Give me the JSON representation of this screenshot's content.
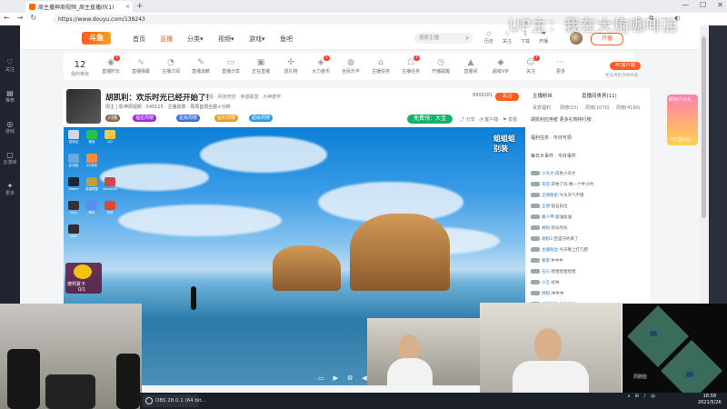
{
  "browser": {
    "tab_title": "周主播神周视频_周主直播间(1)",
    "tab_close": "×",
    "new_tab": "+",
    "window_controls": [
      "—",
      "☐",
      "✕"
    ],
    "url": "https://www.douyu.com/138243",
    "nav": [
      "←",
      "→",
      "↻"
    ],
    "tools": [
      "☆",
      "⧉",
      "⋯",
      "◐"
    ]
  },
  "watermark": "UP主：我在大炮咖啡店",
  "sidebar": {
    "items": [
      {
        "icon": "♡",
        "label": "关注"
      },
      {
        "icon": "▤",
        "label": "推荐"
      },
      {
        "icon": "◎",
        "label": "游戏"
      },
      {
        "icon": "▢",
        "label": "云游戏"
      },
      {
        "icon": "✦",
        "label": "更多"
      }
    ]
  },
  "site": {
    "logo": "斗鱼",
    "nav": [
      "首页",
      "直播",
      "分类",
      "视频",
      "游戏",
      "鱼吧"
    ],
    "nav_arrows": [
      "",
      "",
      "▾",
      "▾",
      "▾",
      ""
    ],
    "search_placeholder": "搜索主播",
    "search_icon": "⌕",
    "topics": [
      {
        "icon": "◇",
        "label": "历史"
      },
      {
        "icon": "☆",
        "label": "关注"
      },
      {
        "icon": "⇩",
        "label": "下载"
      },
      {
        "icon": "⚑",
        "label": "开播"
      }
    ],
    "open_live": "开播"
  },
  "tasks": {
    "level": "12",
    "level_label": "我的等级",
    "items": [
      {
        "icon": "◉",
        "label": "直播时长",
        "badge": "1"
      },
      {
        "icon": "∿",
        "label": "直播弹幕",
        "badge": ""
      },
      {
        "icon": "◔",
        "label": "主播订阅",
        "badge": ""
      },
      {
        "icon": "✎",
        "label": "直播道歉",
        "badge": ""
      },
      {
        "icon": "▭",
        "label": "直播分享",
        "badge": ""
      },
      {
        "icon": "▣",
        "label": "正在直播",
        "badge": ""
      },
      {
        "icon": "✣",
        "label": "送礼物",
        "badge": ""
      },
      {
        "icon": "◈",
        "label": "大力金币",
        "badge": "1"
      },
      {
        "icon": "◍",
        "label": "全民乐平",
        "badge": ""
      },
      {
        "icon": "⌂",
        "label": "主播任务",
        "badge": ""
      },
      {
        "icon": "☖",
        "label": "主播任务",
        "badge": "1"
      },
      {
        "icon": "◷",
        "label": "开播提醒",
        "badge": ""
      },
      {
        "icon": "▲",
        "label": "直播间",
        "badge": ""
      },
      {
        "icon": "◆",
        "label": "超级VIP",
        "badge": ""
      },
      {
        "icon": "☺",
        "label": "关注",
        "badge": "1"
      },
      {
        "icon": "⋯",
        "label": "更多",
        "badge": ""
      }
    ],
    "pc_client": "PC客户端",
    "pc_sub": "更高清更流畅体验"
  },
  "room": {
    "title": "胡凯利：欢乐时光已经开始了！",
    "subtitle": "举报 · 网游竞技 · 英雄联盟 · 大神教学",
    "stats": "周主 | 影神周视频 · 540115 · 主播勋章 · 周周首周全勤+分钟",
    "chips": [
      {
        "text": "闪播",
        "color": "#8a6b4a"
      },
      {
        "text": "福星周榜",
        "color": "#9c2bd6"
      },
      {
        "text": "星级周榜",
        "color": "#3c6fe0"
      },
      {
        "text": "钻石周榜",
        "color": "#e3a21b"
      },
      {
        "text": "超级周榜",
        "color": "#2b9be0"
      }
    ],
    "hot": "8900281",
    "follow": "关注",
    "free_gift": "免费领：大宝",
    "tools": "⤴ 分享 · ◔ 客户端 · ⚑ 举报"
  },
  "player": {
    "overlay_text": [
      "蛆蛆蛆",
      "别装"
    ],
    "controls": [
      "▭",
      "▶",
      "⚙",
      "◀)",
      "⛶",
      "⤢"
    ],
    "desktop_icons": [
      "回收站",
      "微信",
      "QQ",
      "此电脑",
      "QQ音乐",
      "Steam",
      "英雄联盟",
      "WeGame",
      "Epic",
      "腾讯",
      "网易",
      "OBS"
    ],
    "game_badge_title": "德邦夏卡",
    "game_badge_num": "0/1"
  },
  "chat": {
    "tabs": [
      "主播粉丝",
      "直播间贵宾(11)"
    ],
    "subs": [
      "贵宾福利",
      "周榜(10)",
      "周榜(1070)",
      "周榜(4190)"
    ],
    "rank_rows": [
      "胡凯利应用者 更多礼物排行榜",
      "福利任务 · 今日可领",
      "每日大事件 · 今日事件"
    ],
    "lines": [
      {
        "user": "小天才:",
        "text": "白色小天才"
      },
      {
        "user": "花花:",
        "text": "开始了吗 晚一个半小时"
      },
      {
        "user": "正德郁星:",
        "text": "今天天气不错"
      },
      {
        "user": "正德:",
        "text": "钻石段位"
      },
      {
        "user": "路人甲:",
        "text": "加油加油"
      },
      {
        "user": "胡粉:",
        "text": "欢乐时光"
      },
      {
        "user": "胡粉2:",
        "text": "百里守约来了"
      },
      {
        "user": "主播粉丝:",
        "text": "今天晚上打几把"
      },
      {
        "user": "看客:",
        "text": "牛牛牛"
      },
      {
        "user": "石头:",
        "text": "哈哈哈哈哈哈"
      },
      {
        "user": "小王:",
        "text": "好帅"
      },
      {
        "user": "周粉:",
        "text": "冲冲冲"
      },
      {
        "user": "胡凯利粉:",
        "text": "666666"
      },
      {
        "user": "某某:",
        "text": "主播什么时候上分"
      },
      {
        "user": "路人:",
        "text": "天天开心"
      },
      {
        "user": "德邦:",
        "text": "这把能赢"
      },
      {
        "user": "小花:",
        "text": "来了来了"
      },
      {
        "user": "阿杰:",
        "text": "刷个礼物"
      },
      {
        "user": "明明:",
        "text": "晚上好"
      }
    ]
  },
  "gift_card": {
    "title": "新用户大礼",
    "sub": "7天送好礼"
  },
  "minimap": {
    "label": "周腕脸"
  },
  "taskbar": {
    "obs": "OBS 28.0.1 (64 bit...",
    "tray": [
      "∧",
      "⊞",
      "♪",
      "中"
    ],
    "time": "18:58",
    "date": "2021/5/26"
  }
}
